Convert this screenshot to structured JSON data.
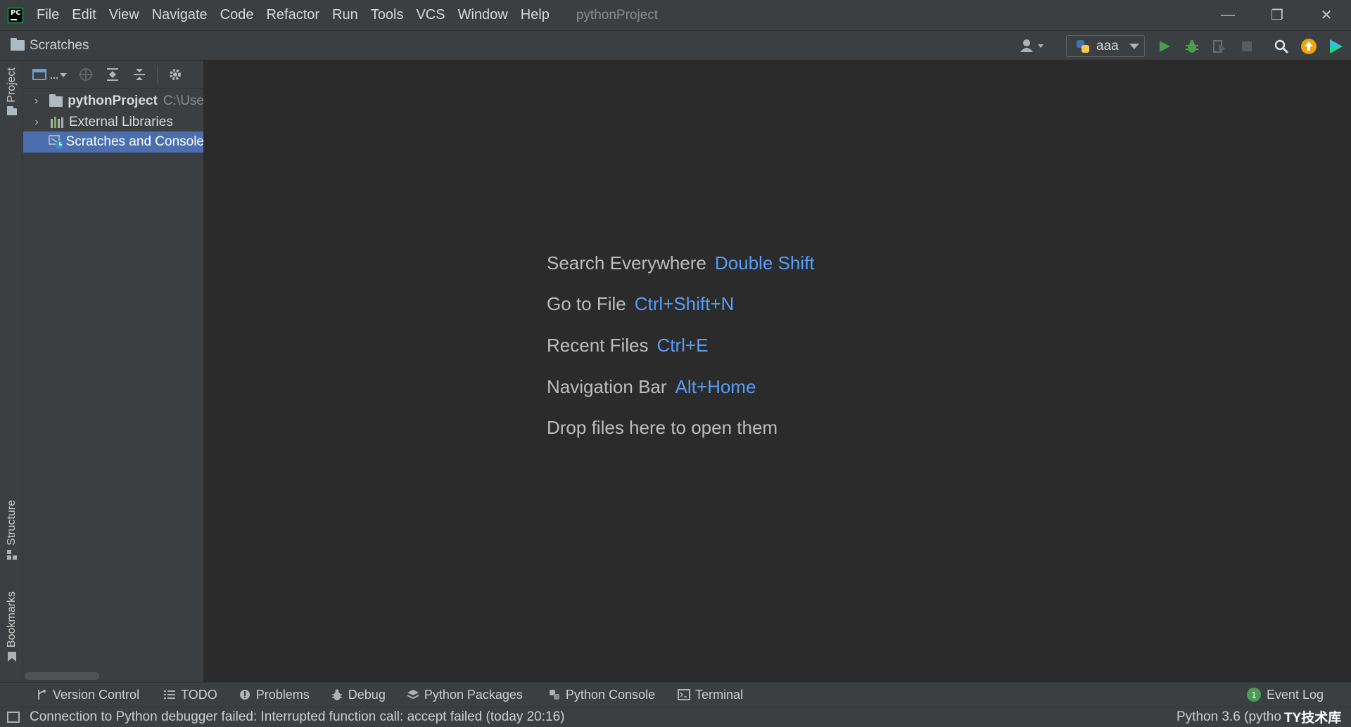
{
  "menu": [
    "File",
    "Edit",
    "View",
    "Navigate",
    "Code",
    "Refactor",
    "Run",
    "Tools",
    "VCS",
    "Window",
    "Help"
  ],
  "window_title": "pythonProject",
  "window_controls": {
    "minimize": "—",
    "restore": "❐",
    "close": "✕"
  },
  "app_logo_text": "PC",
  "breadcrumb": "Scratches",
  "run_config": "aaa",
  "colors": {
    "accent": "#589df6",
    "run": "#499c54",
    "selection": "#4b6eaf",
    "update_badge": "#f0a30a"
  },
  "project_panel": {
    "tree": [
      {
        "name": "pythonProject",
        "path": "C:\\Use",
        "expandable": true
      },
      {
        "name": "External Libraries",
        "expandable": true
      },
      {
        "name": "Scratches and Console",
        "selected": true
      }
    ]
  },
  "left_stripe": {
    "project": "Project",
    "structure": "Structure",
    "bookmarks": "Bookmarks"
  },
  "editor_hints": [
    {
      "text": "Search Everywhere",
      "key": "Double Shift"
    },
    {
      "text": "Go to File",
      "key": "Ctrl+Shift+N"
    },
    {
      "text": "Recent Files",
      "key": "Ctrl+E"
    },
    {
      "text": "Navigation Bar",
      "key": "Alt+Home"
    },
    {
      "text": "Drop files here to open them",
      "key": ""
    }
  ],
  "bottom_tabs": [
    "Version Control",
    "TODO",
    "Problems",
    "Debug",
    "Python Packages",
    "Python Console",
    "Terminal"
  ],
  "event_log": {
    "label": "Event Log",
    "count": "1"
  },
  "status": {
    "message": "Connection to Python debugger failed: Interrupted function call: accept failed (today 20:16)",
    "interpreter": "Python 3.6 (pytho"
  },
  "watermark": "TY技术库"
}
